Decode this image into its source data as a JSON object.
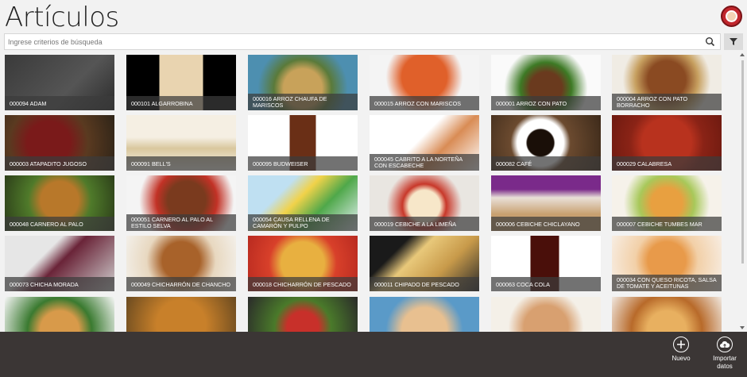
{
  "header": {
    "title": "Artículos"
  },
  "search": {
    "placeholder": "Ingrese criterios de búsqueda"
  },
  "items": [
    {
      "label": "000094 ADAM",
      "bg": "linear-gradient(135deg,#3a3a3a,#555 60%,#2b2b2b)"
    },
    {
      "label": "000101 ALGARROBINA",
      "bg": "linear-gradient(90deg,#000 0 30%,#e9d4b0 30% 70%,#000 70%)"
    },
    {
      "label": "000016 ARROZ CHAUFA DE MARISCOS",
      "bg": "radial-gradient(circle at 50% 60%,#c8a25a 0 30%,#5a7a3a 45%,#4d8fb0 70%)"
    },
    {
      "label": "000015 ARROZ CON MARISCOS",
      "bg": "radial-gradient(circle at 50% 40%,#e0602a 0 35%,#f4f4f4 60%)"
    },
    {
      "label": "000001 ARROZ CON PATO",
      "bg": "radial-gradient(circle at 50% 60%,#6a3a1e 0 25%,#3d7a25 40%,#fafafa 65%)"
    },
    {
      "label": "000004 ARROZ CON PATO BORRACHO",
      "bg": "radial-gradient(circle at 50% 45%,#8a4a22 0 30%,#c7a060 50%,#f0ece4 70%)"
    },
    {
      "label": "000003 ATAPADITO JUGOSO",
      "bg": "radial-gradient(circle at 40% 50%,#7a1a1a 0 30%,#5a3a20 55%,#2e2418)"
    },
    {
      "label": "000091 BELL'S",
      "bg": "linear-gradient(180deg,#f5efe3 0 40%,#d9c79e 60%,#f8f4ec)"
    },
    {
      "label": "000095 BUDWEISER",
      "bg": "linear-gradient(90deg,#fff 0 38%,#6a2f16 38% 62%,#fff 62%)"
    },
    {
      "label": "000045 CABRITO A LA NORTEÑA CON ESCABECHE",
      "bg": "linear-gradient(135deg,#fff 0 45%,#d98c55 65%,#fff)"
    },
    {
      "label": "000082 CAFÉ",
      "bg": "radial-gradient(circle at 45% 50%,#1a0f08 0 20%,#fff 22% 35%,#6b4a2f 45%,#3d2a1a)"
    },
    {
      "label": "000029 CALABRESA",
      "bg": "radial-gradient(circle at 50% 50%,#b8321e 0 40%,#8a2316 60%,#6e1a10)"
    },
    {
      "label": "000048 CARNERO AL PALO",
      "bg": "radial-gradient(circle at 50% 45%,#b8782a 0 30%,#4f7a2a 50%,#2a3a18)"
    },
    {
      "label": "000051 CARNERO AL PALO AL ESTILO SELVA",
      "bg": "radial-gradient(circle at 55% 45%,#7a3a1e 0 28%,#c23226 45%,#f4f4f4 70%)"
    },
    {
      "label": "000054 CAUSA RELLENA DE CAMARÓN Y PULPO",
      "bg": "linear-gradient(135deg,#bfe0f2 0 30%,#f1d24a 45%,#4fa84a 65%,#e8f2f8)"
    },
    {
      "label": "000019 CEBICHE A LA LIMEÑA",
      "bg": "radial-gradient(circle at 50% 55%,#f7e7c9 0 25%,#c8382a 35%,#e9e6e1 60%)"
    },
    {
      "label": "000006 CEBICHE CHICLAYANO",
      "bg": "linear-gradient(180deg,#7a2a8a 0 25%,#e9e0d8 40%,#c8a070 70%)"
    },
    {
      "label": "000007 CEBICHE TUMBES MAR",
      "bg": "radial-gradient(circle at 50% 50%,#e8a040 0 25%,#a8c85a 45%,#f6f2ea 70%)"
    },
    {
      "label": "000073 CHICHA MORADA",
      "bg": "linear-gradient(135deg,#e6e6e6 0 35%,#6a2438 50%,#d0d0d0)"
    },
    {
      "label": "000049 CHICHARRÓN DE CHANCHO",
      "bg": "radial-gradient(circle at 50% 45%,#a8622a 0 30%,#e8d8c0 55%,#f4f2ee)"
    },
    {
      "label": "000018 CHICHARRÓN DE PESCADO",
      "bg": "radial-gradient(circle at 50% 50%,#e8b040 0 35%,#d8402a 55%,#b82a20)"
    },
    {
      "label": "000011 CHIPADO DE PESCADO",
      "bg": "linear-gradient(135deg,#1a1a1a 0 25%,#e8c87a 40%,#c89a4a 65%,#2a2a2a)"
    },
    {
      "label": "000063 COCA COLA",
      "bg": "linear-gradient(90deg,#fff 0 36%,#4a0f0a 36% 62%,#fff 62%)"
    },
    {
      "label": "000034 CON QUESO RICOTA, SALSA DE TOMATE Y ACEITUNAS",
      "bg": "radial-gradient(circle at 50% 45%,#e89a4a 0 30%,#f2d0a8 50%,#f8f0e8)"
    },
    {
      "label": "",
      "bg": "radial-gradient(circle at 50% 60%,#d89a4a 0 30%,#3a7a30 50%,#f6f6f6)"
    },
    {
      "label": "",
      "bg": "radial-gradient(circle at 50% 50%,#c8802a 0 40%,#6a4a20)"
    },
    {
      "label": "",
      "bg": "radial-gradient(circle at 50% 55%,#c8302a 0 25%,#4a7a2a 45%,#2a2a2a)"
    },
    {
      "label": "",
      "bg": "radial-gradient(circle at 50% 60%,#e8c090 0 35%,#5a9ac8 60%)"
    },
    {
      "label": "",
      "bg": "radial-gradient(circle at 50% 55%,#d8a070 0 35%,#f4f0e8 60%)"
    },
    {
      "label": "",
      "bg": "radial-gradient(circle at 50% 60%,#e8b060 0 30%,#b86a2a 55%,#f0e8e0)"
    }
  ],
  "appbar": {
    "new_label": "Nuevo",
    "import_label": "Importar datos"
  },
  "colors": {
    "accent": "#c1272d",
    "appbar": "#3b3635"
  },
  "icons": {
    "search": "search-icon",
    "filter": "filter-icon",
    "add": "add-circle-icon",
    "import": "cloud-upload-icon"
  }
}
